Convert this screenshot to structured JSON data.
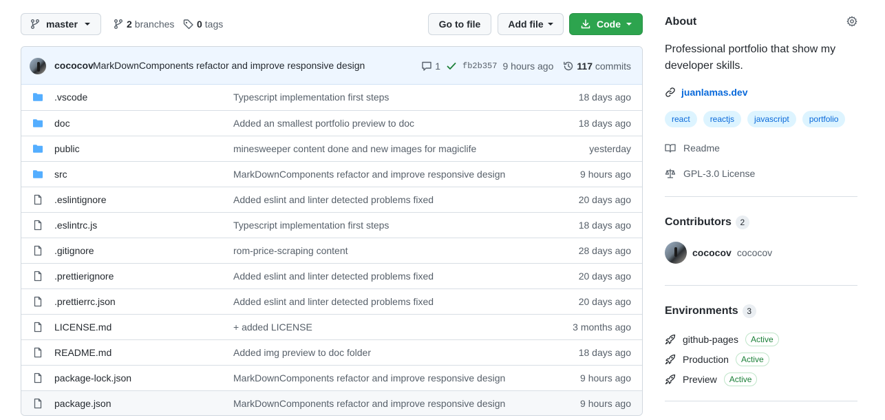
{
  "toolbar": {
    "branch": "master",
    "branches_count": "2",
    "branches_label": "branches",
    "tags_count": "0",
    "tags_label": "tags",
    "goto_file": "Go to file",
    "add_file": "Add file",
    "code": "Code"
  },
  "commit": {
    "author": "cococov",
    "message": "MarkDownComponents refactor and improve responsive design",
    "comments": "1",
    "sha": "fb2b357",
    "time": "9 hours ago",
    "commits_count": "117",
    "commits_label": "commits"
  },
  "files": [
    {
      "name": ".vscode",
      "type": "folder",
      "commit": "Typescript implementation first steps",
      "age": "18 days ago"
    },
    {
      "name": "doc",
      "type": "folder",
      "commit": "Added an smallest portfolio preview to doc",
      "age": "18 days ago"
    },
    {
      "name": "public",
      "type": "folder",
      "commit": "minesweeper content done and new images for magiclife",
      "age": "yesterday"
    },
    {
      "name": "src",
      "type": "folder",
      "commit": "MarkDownComponents refactor and improve responsive design",
      "age": "9 hours ago"
    },
    {
      "name": ".eslintignore",
      "type": "file",
      "commit": "Added eslint and linter detected problems fixed",
      "age": "20 days ago"
    },
    {
      "name": ".eslintrc.js",
      "type": "file",
      "commit": "Typescript implementation first steps",
      "age": "18 days ago"
    },
    {
      "name": ".gitignore",
      "type": "file",
      "commit": "rom-price-scraping content",
      "age": "28 days ago"
    },
    {
      "name": ".prettierignore",
      "type": "file",
      "commit": "Added eslint and linter detected problems fixed",
      "age": "20 days ago"
    },
    {
      "name": ".prettierrc.json",
      "type": "file",
      "commit": "Added eslint and linter detected problems fixed",
      "age": "20 days ago"
    },
    {
      "name": "LICENSE.md",
      "type": "file",
      "commit": "+ added LICENSE",
      "age": "3 months ago"
    },
    {
      "name": "README.md",
      "type": "file",
      "commit": "Added img preview to doc folder",
      "age": "18 days ago"
    },
    {
      "name": "package-lock.json",
      "type": "file",
      "commit": "MarkDownComponents refactor and improve responsive design",
      "age": "9 hours ago"
    },
    {
      "name": "package.json",
      "type": "file",
      "commit": "MarkDownComponents refactor and improve responsive design",
      "age": "9 hours ago"
    }
  ],
  "about": {
    "title": "About",
    "description": "Professional portfolio that show my developer skills.",
    "website": "juanlamas.dev",
    "topics": [
      "react",
      "reactjs",
      "javascript",
      "portfolio"
    ],
    "readme": "Readme",
    "license": "GPL-3.0 License"
  },
  "contributors": {
    "title": "Contributors",
    "count": "2",
    "items": [
      {
        "login": "cococov",
        "name": "cococov"
      }
    ]
  },
  "environments": {
    "title": "Environments",
    "count": "3",
    "items": [
      {
        "name": "github-pages",
        "status": "Active"
      },
      {
        "name": "Production",
        "status": "Active"
      },
      {
        "name": "Preview",
        "status": "Active"
      }
    ]
  },
  "colors": {
    "accent": "#0969da",
    "primary_button": "#2da44e",
    "folder_icon": "#54aeff",
    "active_badge": "#1a7f37"
  }
}
